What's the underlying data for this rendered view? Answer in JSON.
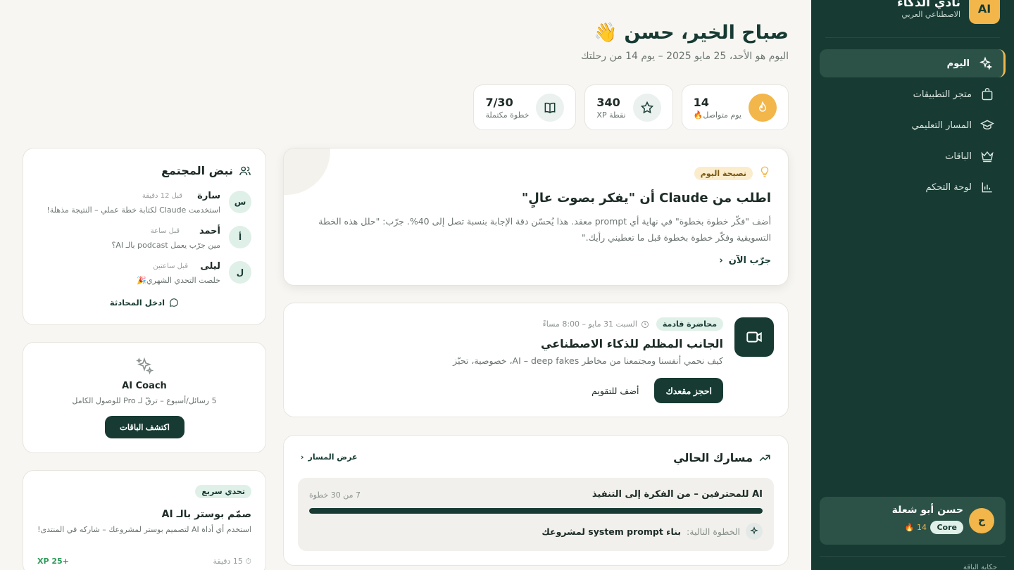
{
  "brand": {
    "logo": "AI",
    "name": "نادي الذكاء",
    "subtitle": "الاصطناعي العربي"
  },
  "nav": [
    {
      "label": "اليوم",
      "icon": "sparkles-icon",
      "active": true
    },
    {
      "label": "متجر التطبيقات",
      "icon": "bag-icon",
      "active": false
    },
    {
      "label": "المسار التعليمي",
      "icon": "graduation-cap-icon",
      "active": false
    },
    {
      "label": "الباقات",
      "icon": "crown-icon",
      "active": false
    },
    {
      "label": "لوحة التحكم",
      "icon": "bar-chart-icon",
      "active": false
    }
  ],
  "user": {
    "initial": "ح",
    "name": "حسن أبو شعلة",
    "plan": "Core",
    "streak": "14 🔥"
  },
  "sidebar_footer": "حكاية الباقة",
  "header": {
    "greeting": "صباح الخير، حسن 👋",
    "subtitle": "اليوم هو الأحد، 25 مايو 2025 – يوم 14 من رحلتك"
  },
  "stats": [
    {
      "value": "14",
      "label": "يوم متواصل🔥",
      "icon": "flame-icon"
    },
    {
      "value": "340",
      "label": "نقطة XP",
      "icon": "star-icon"
    },
    {
      "value": "7/30",
      "label": "خطوة مكتملة",
      "icon": "book-icon"
    }
  ],
  "tip": {
    "badge": "نصيحة اليوم",
    "title": "اطلب من Claude أن \"يفكر بصوت عالٍ\"",
    "body": "أضف \"فكّر خطوة بخطوة\" في نهاية أي prompt معقد. هذا يُحسّن دقة الإجابة بنسبة تصل إلى 40%. جرّب: \"حلل هذه الخطة التسويقية وفكّر خطوة بخطوة قبل ما تعطيني رأيك.\"",
    "cta": "جرّب الآن"
  },
  "lecture": {
    "badge": "محاضرة قادمة",
    "time": "السبت 31 مايو – 8:00 مساءً",
    "title": "الجانب المظلم للذكاء الاصطناعي",
    "description": "كيف نحمي أنفسنا ومجتمعنا من مخاطر AI – deep fakes، خصوصية، تحيّز",
    "primary_button": "احجز مقعدك",
    "secondary_button": "أضف للتقويم"
  },
  "path": {
    "title": "مسارك الحالي",
    "view_link": "عرض المسار",
    "course_name": "AI للمحترفين – من الفكرة إلى التنفيذ",
    "steps": "7 من 30 خطوة",
    "progress": 1.0,
    "next_label": "الخطوة التالية:",
    "next_value": "بناء system prompt لمشروعك"
  },
  "community": {
    "title": "نبض المجتمع",
    "items": [
      {
        "initial": "س",
        "name": "سارة",
        "time": "قبل 12 دقيقة",
        "text": "استخدمت Claude لكتابة خطة عملي – النتيجة مذهلة!"
      },
      {
        "initial": "أ",
        "name": "أحمد",
        "time": "قبل ساعة",
        "text": "مين جرّب يعمل podcast بالـ AI؟"
      },
      {
        "initial": "ل",
        "name": "ليلى",
        "time": "قبل ساعتين",
        "text": "خلصت التحدي الشهري🎉"
      }
    ],
    "cta": "ادخل المحادثة"
  },
  "coach": {
    "title": "AI Coach",
    "description": "5 رسائل/أسبوع – ترقّ لـ Pro للوصول الكامل",
    "button": "اكتشف الباقات"
  },
  "challenge": {
    "badge": "تحدي سريع",
    "title": "صمّم بوستر بالـ AI",
    "description": "استخدم أي أداة AI لتصميم بوستر لمشروعك – شاركه في المنتدى!",
    "time": "⏱ 15 دقيقة",
    "xp": "+25 XP"
  },
  "colors": {
    "primary": "#173b33",
    "accent": "#f2b64a",
    "background": "#f7f6f2",
    "xp_green": "#2f9a5b"
  }
}
